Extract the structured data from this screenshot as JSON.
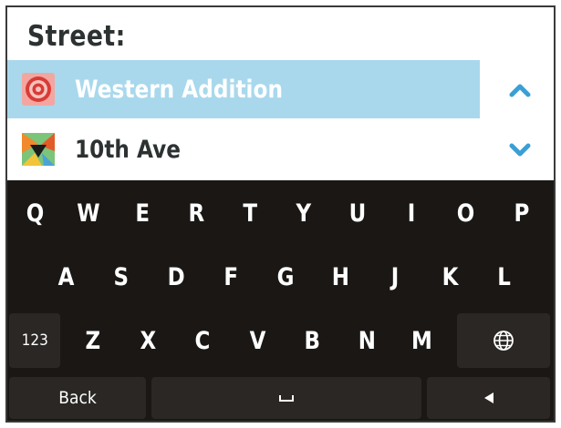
{
  "header": {
    "title": "Street:"
  },
  "suggestions": [
    {
      "label": "Western Addition",
      "icon": "poi-target-icon",
      "selected": true
    },
    {
      "label": "10th Ave",
      "icon": "map-pin-icon",
      "selected": false
    }
  ],
  "scroll": {
    "up_icon": "chevron-up-icon",
    "down_icon": "chevron-down-icon"
  },
  "keyboard": {
    "row1": [
      "Q",
      "W",
      "E",
      "R",
      "T",
      "Y",
      "U",
      "I",
      "O",
      "P"
    ],
    "row2": [
      "A",
      "S",
      "D",
      "F",
      "G",
      "H",
      "J",
      "K",
      "L"
    ],
    "row3": [
      "Z",
      "X",
      "C",
      "V",
      "B",
      "N",
      "M"
    ],
    "numbers_label": "123",
    "globe_icon": "globe-icon",
    "back_label": "Back",
    "space_icon": "space-bar-icon",
    "left_arrow_icon": "left-arrow-icon"
  },
  "colors": {
    "highlight": "#a9d8ed",
    "accent": "#3a9fd6",
    "keyboard_bg": "#1a1715",
    "key_fn_bg": "#2a2724",
    "title_text": "#2c3132"
  }
}
